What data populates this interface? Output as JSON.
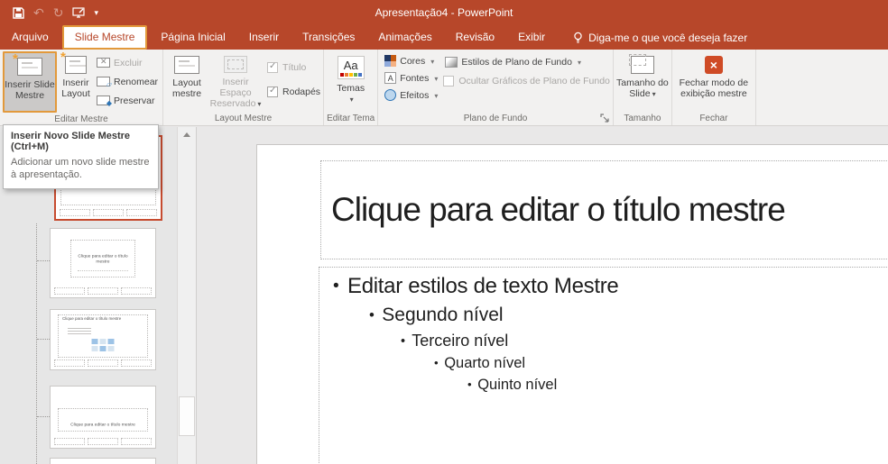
{
  "window": {
    "title": "Apresentação4 - PowerPoint"
  },
  "tabs": {
    "file": "Arquivo",
    "slide_mestre": "Slide Mestre",
    "pagina_inicial": "Página Inicial",
    "inserir": "Inserir",
    "transicoes": "Transições",
    "animacoes": "Animações",
    "revisao": "Revisão",
    "exibir": "Exibir",
    "tellme": "Diga-me o que você deseja fazer"
  },
  "ribbon": {
    "editar_mestre": {
      "label": "Editar Mestre",
      "inserir_slide_mestre": "Inserir Slide Mestre",
      "inserir_layout": "Inserir Layout",
      "excluir": "Excluir",
      "renomear": "Renomear",
      "preservar": "Preservar"
    },
    "layout_mestre": {
      "label": "Layout Mestre",
      "layout_mestre_btn": "Layout mestre",
      "inserir_espaco": "Inserir Espaço Reservado",
      "titulo": "Título",
      "rodapes": "Rodapés"
    },
    "editar_tema": {
      "label": "Editar Tema",
      "temas": "Temas",
      "temas_icon_text": "Aa"
    },
    "plano_fundo": {
      "label": "Plano de Fundo",
      "cores": "Cores",
      "fontes": "Fontes",
      "fontes_icon_text": "A",
      "efeitos": "Efeitos",
      "estilos": "Estilos de Plano de Fundo",
      "ocultar": "Ocultar Gráficos de Plano de Fundo"
    },
    "tamanho": {
      "label": "Tamanho",
      "tamanho_slide": "Tamanho do Slide"
    },
    "fechar": {
      "label": "Fechar",
      "fechar_modo": "Fechar modo de exibição mestre"
    }
  },
  "tooltip": {
    "title": "Inserir Novo Slide Mestre (Ctrl+M)",
    "body": "Adicionar um novo slide mestre à apresentação."
  },
  "thumbnails": {
    "layout_title": "Clique para editar o título mestre"
  },
  "slide": {
    "title": "Clique para editar o título mestre",
    "level1": "Editar estilos de texto Mestre",
    "level2": "Segundo nível",
    "level3": "Terceiro nível",
    "level4": "Quarto nível",
    "level5": "Quinto nível"
  },
  "colors": {
    "titlebar": "#B7472A",
    "annotation": "#E2993B",
    "selection_border": "#C64B2F",
    "close_button": "#CF4B26",
    "ribbon_bg": "#F2F1F0"
  }
}
